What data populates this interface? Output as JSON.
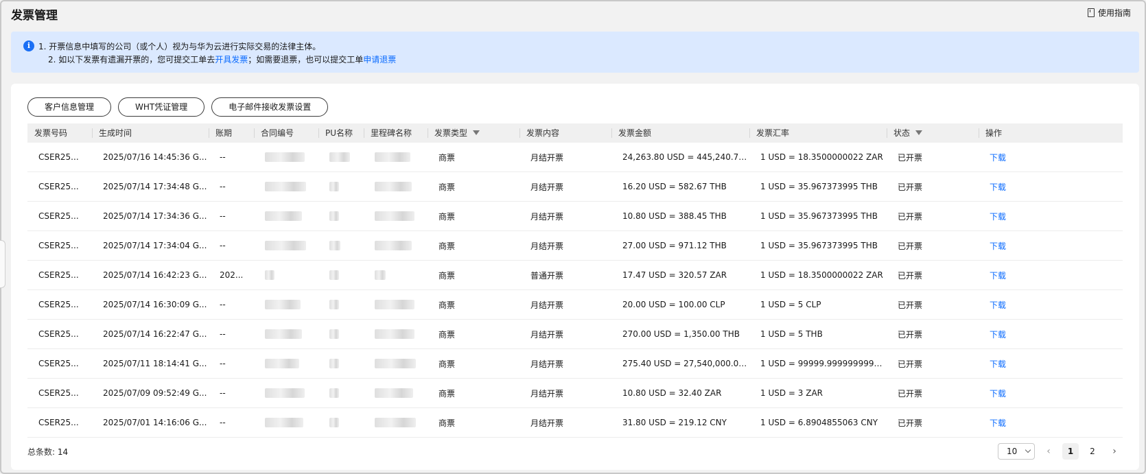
{
  "header": {
    "title": "发票管理",
    "guide_label": "使用指南"
  },
  "notice": {
    "line1": "1. 开票信息中填写的公司（或个人）视为与华为云进行实际交易的法律主体。",
    "line2_prefix": "2. 如以下发票有遗漏开票的，您可提交工单去",
    "line2_link1": "开具发票",
    "line2_mid": "；如需要退票，也可以提交工单",
    "line2_link2": "申请退票"
  },
  "toolbar": {
    "buttons": [
      "客户信息管理",
      "WHT凭证管理",
      "电子邮件接收发票设置"
    ]
  },
  "table": {
    "columns": [
      "发票号码",
      "生成时间",
      "账期",
      "合同编号",
      "PU名称",
      "里程碑名称",
      "发票类型",
      "发票内容",
      "发票金额",
      "发票汇率",
      "状态",
      "操作"
    ],
    "rows": [
      {
        "id": "CSER25...",
        "time": "2025/07/16 14:45:36 G...",
        "period": "--",
        "type": "商票",
        "content": "月结开票",
        "amount": "24,263.80 USD = 445,240.73...",
        "rate": "1 USD = 18.3500000022 ZAR",
        "status": "已开票",
        "action": "下载"
      },
      {
        "id": "CSER25...",
        "time": "2025/07/14 17:34:48 G...",
        "period": "--",
        "type": "商票",
        "content": "月结开票",
        "amount": "16.20 USD = 582.67 THB",
        "rate": "1 USD = 35.967373995 THB",
        "status": "已开票",
        "action": "下载"
      },
      {
        "id": "CSER25...",
        "time": "2025/07/14 17:34:36 G...",
        "period": "--",
        "type": "商票",
        "content": "月结开票",
        "amount": "10.80 USD = 388.45 THB",
        "rate": "1 USD = 35.967373995 THB",
        "status": "已开票",
        "action": "下载"
      },
      {
        "id": "CSER25...",
        "time": "2025/07/14 17:34:04 G...",
        "period": "--",
        "type": "商票",
        "content": "月结开票",
        "amount": "27.00 USD = 971.12 THB",
        "rate": "1 USD = 35.967373995 THB",
        "status": "已开票",
        "action": "下载"
      },
      {
        "id": "CSER25...",
        "time": "2025/07/14 16:42:23 G...",
        "period": "202...",
        "type": "商票",
        "content": "普通开票",
        "amount": "17.47 USD = 320.57 ZAR",
        "rate": "1 USD = 18.3500000022 ZAR",
        "status": "已开票",
        "action": "下载"
      },
      {
        "id": "CSER25...",
        "time": "2025/07/14 16:30:09 G...",
        "period": "--",
        "type": "商票",
        "content": "月结开票",
        "amount": "20.00 USD = 100.00 CLP",
        "rate": "1 USD = 5 CLP",
        "status": "已开票",
        "action": "下载"
      },
      {
        "id": "CSER25...",
        "time": "2025/07/14 16:22:47 G...",
        "period": "--",
        "type": "商票",
        "content": "月结开票",
        "amount": "270.00 USD = 1,350.00 THB",
        "rate": "1 USD = 5 THB",
        "status": "已开票",
        "action": "下载"
      },
      {
        "id": "CSER25...",
        "time": "2025/07/11 18:14:41 G...",
        "period": "--",
        "type": "商票",
        "content": "月结开票",
        "amount": "275.40 USD = 27,540,000.00...",
        "rate": "1 USD = 99999.9999999999 ...",
        "status": "已开票",
        "action": "下载"
      },
      {
        "id": "CSER25...",
        "time": "2025/07/09 09:52:49 G...",
        "period": "--",
        "type": "商票",
        "content": "月结开票",
        "amount": "10.80 USD = 32.40 ZAR",
        "rate": "1 USD = 3 ZAR",
        "status": "已开票",
        "action": "下载"
      },
      {
        "id": "CSER25...",
        "time": "2025/07/01 14:16:06 G...",
        "period": "--",
        "type": "商票",
        "content": "月结开票",
        "amount": "31.80 USD = 219.12 CNY",
        "rate": "1 USD = 6.8904855063 CNY",
        "status": "已开票",
        "action": "下载"
      }
    ]
  },
  "footer": {
    "total_label": "总条数:",
    "total_value": "14"
  },
  "pagination": {
    "page_size": "10",
    "pages": [
      "1",
      "2"
    ],
    "current": "1"
  },
  "colors": {
    "accent": "#0a6bff",
    "notice_bg": "#dbe9ff"
  }
}
